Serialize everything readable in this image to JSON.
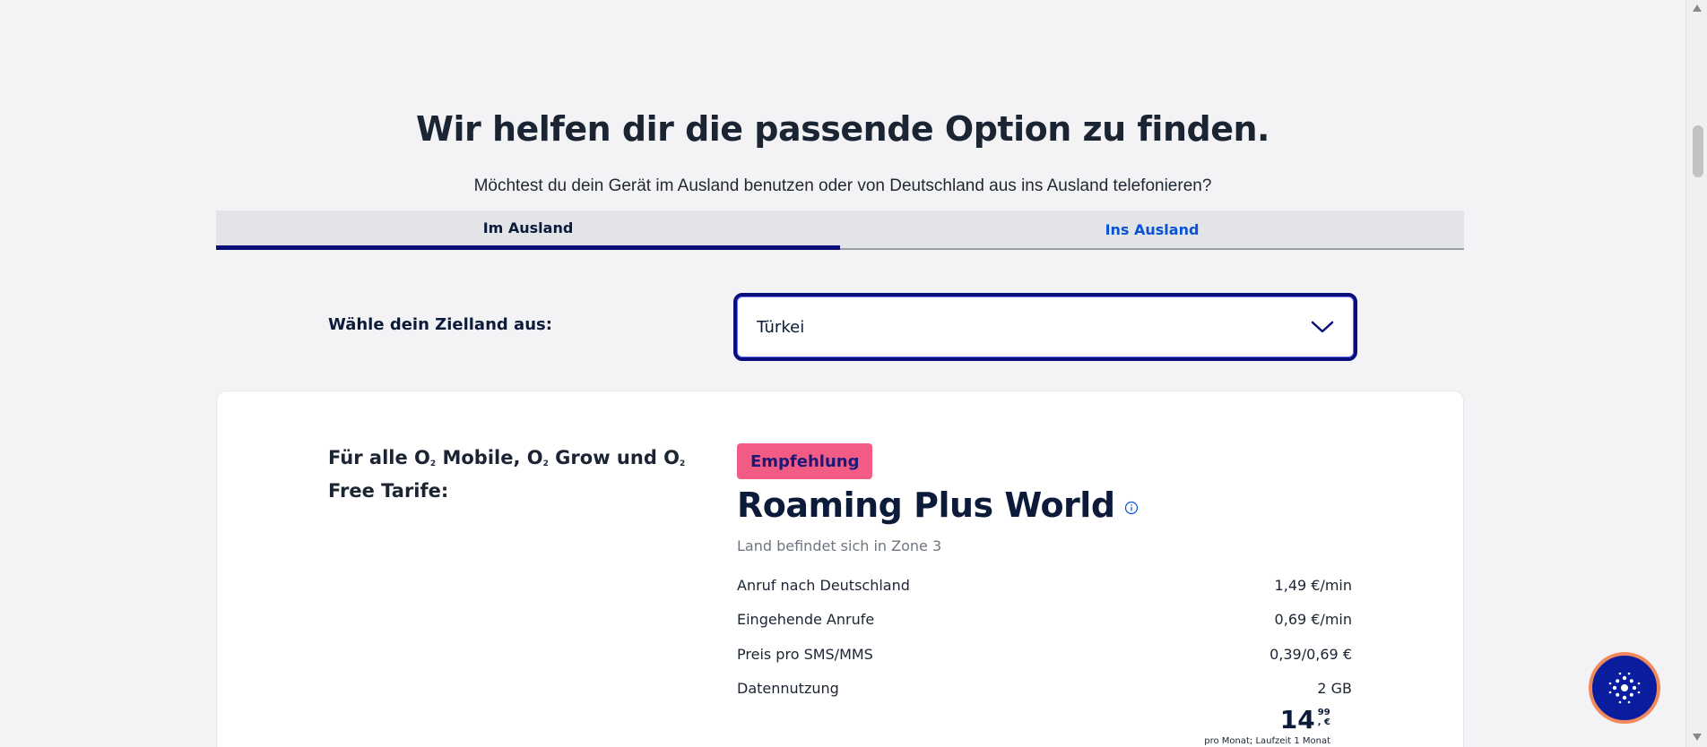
{
  "header": {
    "title": "Wir helfen dir die passende Option zu finden.",
    "subtitle": "Möchtest du dein Gerät im Ausland benutzen oder von Deutschland aus ins Ausland telefonieren?"
  },
  "tabs": [
    {
      "label": "Im Ausland",
      "active": true
    },
    {
      "label": "Ins Ausland",
      "active": false
    }
  ],
  "destination": {
    "label": "Wähle dein Zielland aus:",
    "selected": "Türkei"
  },
  "card": {
    "tariff_prefix": "Für alle O",
    "tariff_mid1": " Mobile, O",
    "tariff_mid2": " Grow und O",
    "tariff_suffix": " Free Tarife:",
    "subscript": "2",
    "badge": "Empfehlung",
    "product_title": "Roaming Plus World",
    "zone": "Land befindet sich in Zone 3",
    "rows": [
      {
        "label": "Anruf nach Deutschland",
        "value": "1,49 €/min"
      },
      {
        "label": "Eingehende Anrufe",
        "value": "0,69 €/min"
      },
      {
        "label": "Preis pro SMS/MMS",
        "value": "0,39/0,69 €"
      },
      {
        "label": "Datennutzung",
        "value": "2 GB"
      }
    ],
    "price_main": "14",
    "price_cents": "99",
    "price_currency": ", €",
    "price_note": "pro Monat; Laufzeit 1 Monat"
  },
  "colors": {
    "accent": "#0a0e7a",
    "link": "#0a52d6",
    "badge": "#f25c84",
    "chat_fab": "#0a1d9e"
  }
}
